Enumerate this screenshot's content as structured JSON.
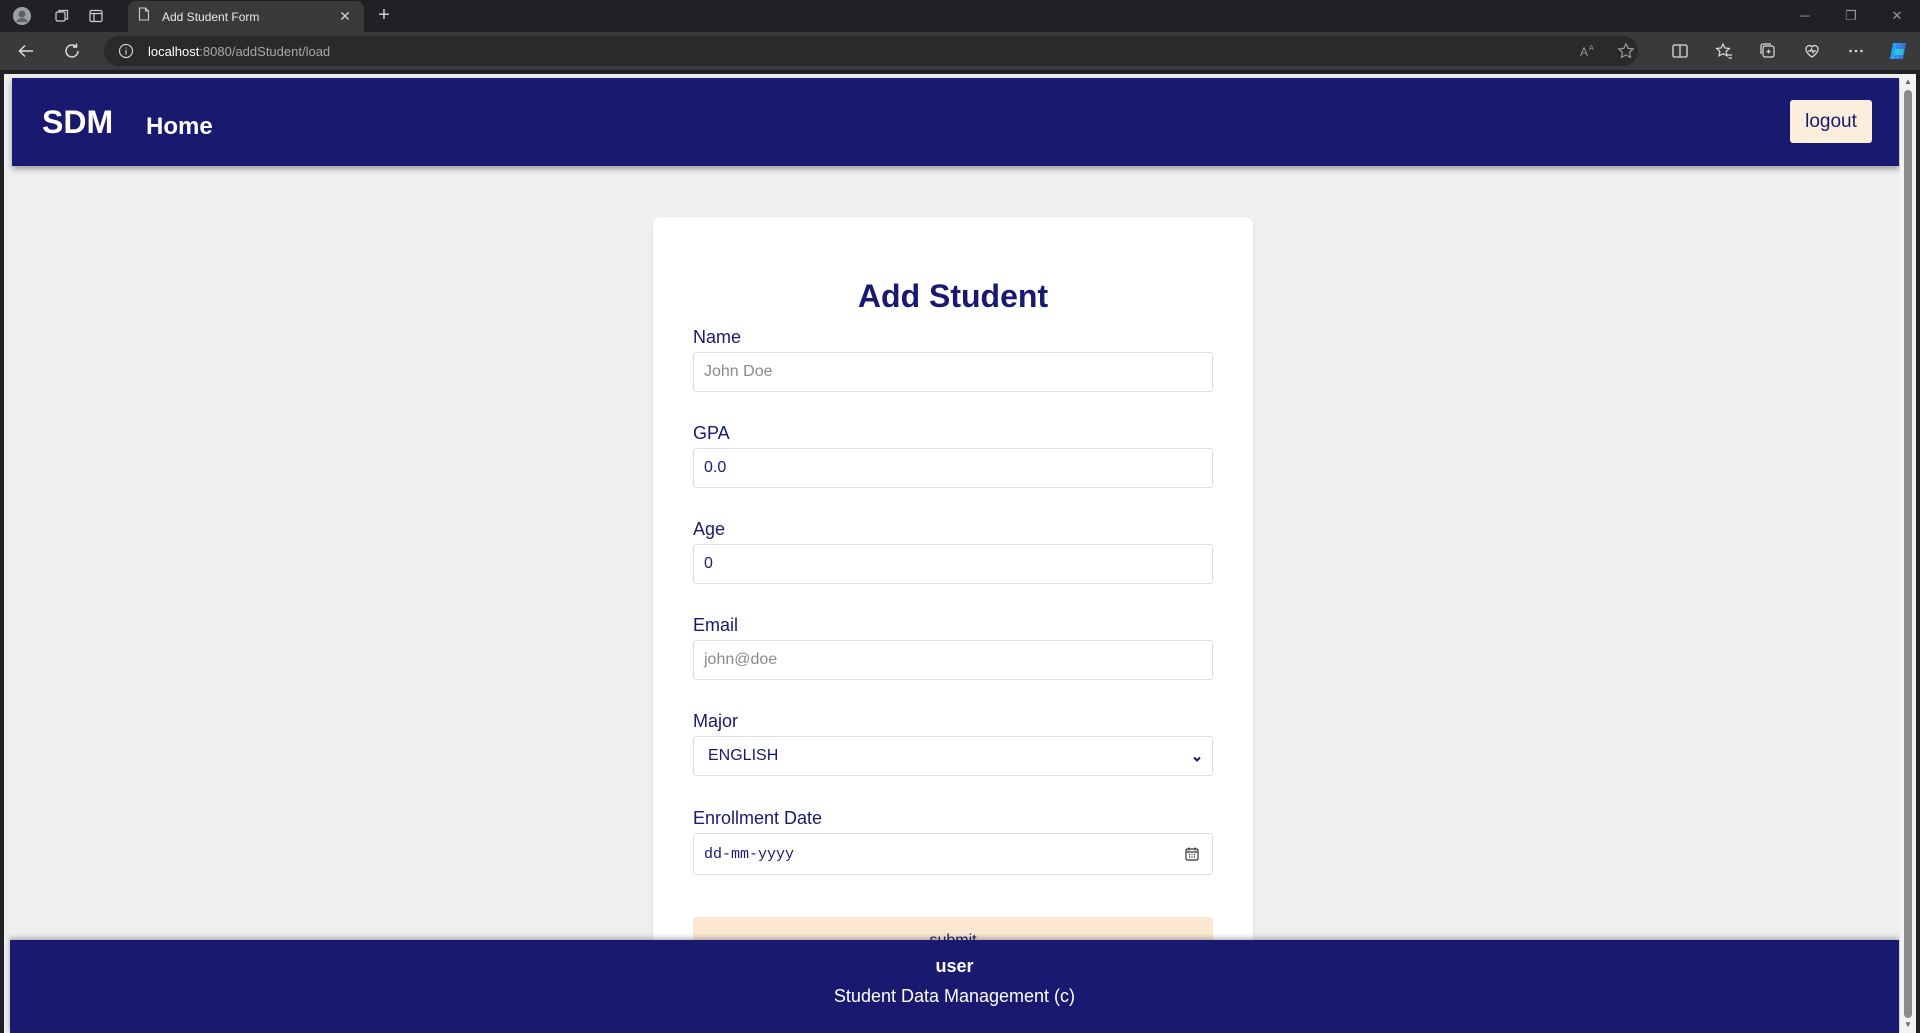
{
  "browser": {
    "tab_title": "Add Student Form",
    "url_host": "localhost",
    "url_rest": ":8080/addStudent/load",
    "new_tab_label": "+"
  },
  "nav": {
    "brand": "SDM",
    "home_label": "Home",
    "logout_label": "logout"
  },
  "form": {
    "title": "Add Student",
    "fields": [
      {
        "label": "Name",
        "value": "",
        "placeholder": "John Doe"
      },
      {
        "label": "GPA",
        "value": "0.0",
        "placeholder": ""
      },
      {
        "label": "Age",
        "value": "0",
        "placeholder": ""
      },
      {
        "label": "Email",
        "value": "",
        "placeholder": "john@doe"
      },
      {
        "label": "Major",
        "value": "ENGLISH",
        "placeholder": ""
      },
      {
        "label": "Enrollment Date",
        "value": "",
        "placeholder": "dd-mm-yyyy"
      }
    ],
    "submit_label": "submit"
  },
  "footer": {
    "user": "user",
    "copyright": "Student Data Management (c)"
  },
  "colors": {
    "navy": "#191970",
    "button_bg": "#fbeedd",
    "submit_bg": "#fbe8d3",
    "page_bg": "#efefef"
  },
  "icons": [
    "profile-icon",
    "workspaces-icon",
    "tab-actions-icon",
    "page-icon",
    "close-icon",
    "back-icon",
    "refresh-icon",
    "info-icon",
    "read-aloud-icon",
    "favorite-star-icon",
    "split-screen-icon",
    "favorites-icon",
    "collections-icon",
    "performance-icon",
    "more-icon",
    "copilot-icon",
    "chevron-down-icon",
    "calendar-icon"
  ]
}
